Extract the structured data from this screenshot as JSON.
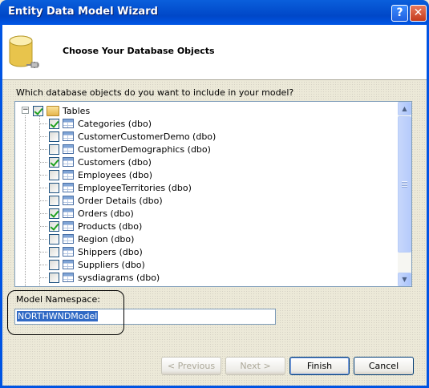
{
  "window": {
    "title": "Entity Data Model Wizard",
    "help_label": "?",
    "close_label": "✕"
  },
  "header": {
    "heading": "Choose Your Database Objects",
    "icon": "database-icon"
  },
  "question": "Which database objects do you want to include in your model?",
  "tree": {
    "root": {
      "label": "Tables",
      "checked": true,
      "expander": "−"
    },
    "items": [
      {
        "label": "Categories (dbo)",
        "checked": true
      },
      {
        "label": "CustomerCustomerDemo (dbo)",
        "checked": false
      },
      {
        "label": "CustomerDemographics (dbo)",
        "checked": false
      },
      {
        "label": "Customers (dbo)",
        "checked": true
      },
      {
        "label": "Employees (dbo)",
        "checked": false
      },
      {
        "label": "EmployeeTerritories (dbo)",
        "checked": false
      },
      {
        "label": "Order Details (dbo)",
        "checked": false
      },
      {
        "label": "Orders (dbo)",
        "checked": true
      },
      {
        "label": "Products (dbo)",
        "checked": true
      },
      {
        "label": "Region (dbo)",
        "checked": false
      },
      {
        "label": "Shippers (dbo)",
        "checked": false
      },
      {
        "label": "Suppliers (dbo)",
        "checked": false
      },
      {
        "label": "sysdiagrams (dbo)",
        "checked": false
      }
    ],
    "scroll_up": "▲",
    "scroll_down": "▼"
  },
  "namespace": {
    "label": "Model Namespace:",
    "value": "NORTHWNDModel"
  },
  "buttons": {
    "previous": "< Previous",
    "next": "Next >",
    "finish": "Finish",
    "cancel": "Cancel"
  }
}
